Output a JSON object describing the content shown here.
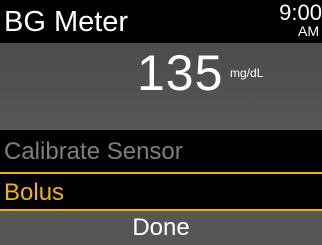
{
  "header": {
    "title": "BG Meter",
    "time": "9:00",
    "ampm": "AM"
  },
  "reading": {
    "value": "135",
    "unit": "mg/dL"
  },
  "menu": {
    "items": [
      {
        "label": "Calibrate Sensor",
        "state": "disabled"
      },
      {
        "label": "Bolus",
        "state": "selected"
      },
      {
        "label": "Done",
        "state": "normal"
      }
    ]
  },
  "colors": {
    "highlight": "#f1b400",
    "disabled_text": "#7f7f7f",
    "panel": "#545755"
  }
}
